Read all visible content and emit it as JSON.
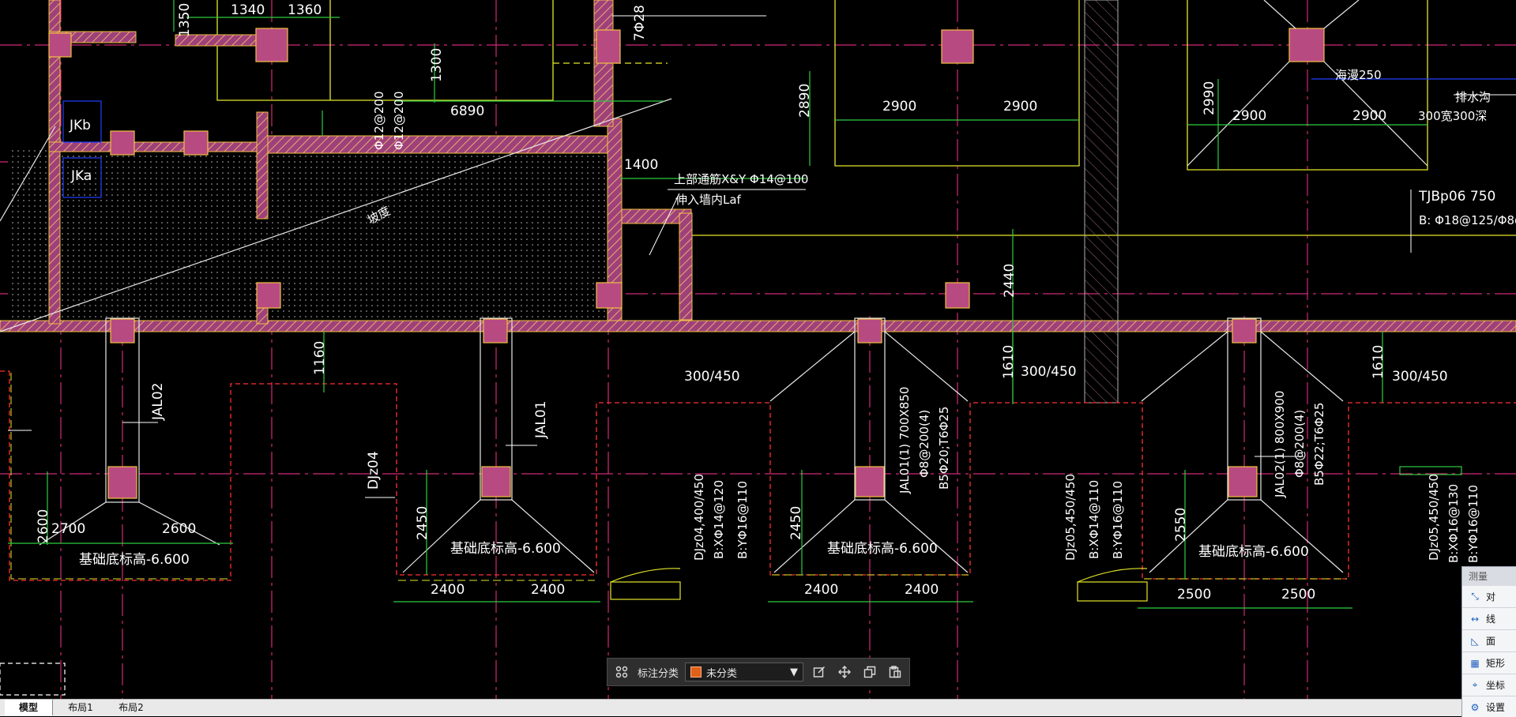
{
  "drawing": {
    "dims": {
      "d1350": "1350",
      "d1340": "1340",
      "d1360": "1360",
      "d1300": "1300",
      "d6890": "6890",
      "d1400": "1400",
      "d2890": "2890",
      "d2900a": "2900",
      "d2900b": "2900",
      "d2990": "2990",
      "d2900c": "2900",
      "d2900d": "2900",
      "d2440": "2440",
      "d1160": "1160",
      "d1610a": "1610",
      "d1610b": "1610",
      "d300_450a": "300/450",
      "d300_450b": "300/450",
      "d300_450c": "300/450",
      "d2700": "2700",
      "d2600a": "2600",
      "d2600b": "2600",
      "d2450a": "2450",
      "d2450b": "2450",
      "d2550": "2550",
      "d2400a": "2400",
      "d2400b": "2400",
      "d2400c": "2400",
      "d2400d": "2400",
      "d2500a": "2500",
      "d2500b": "2500"
    },
    "labels": {
      "jkb": "JKb",
      "jka": "JKa",
      "rebar_phi12": "Φ12@200",
      "rebar_phi12b": "Φ12@200",
      "top_rebar": "上部通筋X&Y Φ14@100",
      "extend": "伸入墙内Laf",
      "rebar7": "7Φ28",
      "haiyan": "海漫250",
      "drain": "排水沟",
      "drain_size": "300宽300深",
      "tjbp": "TJBp06 750",
      "tjbp_b": "B: Φ18@125/Φ8@",
      "jal02a": "JAL02",
      "jal01a": "JAL01",
      "djz04": "DJz04",
      "base_elev1": "基础底标高-6.600",
      "base_elev2": "基础底标高-6.600",
      "base_elev3": "基础底标高-6.600",
      "base_elev4": "基础底标高-6.600",
      "dj_1_a": "DJz04,400/450",
      "dj_1_b": "B:XΦ14@120",
      "dj_1_c": "B:YΦ16@110",
      "jal01_1": "JAL01(1) 700X850",
      "jal01_2": "Φ8@200(4)",
      "jal01_3": "B5Φ20;T6Φ25",
      "dj_2_a": "DJz05,450/450",
      "dj_2_b": "B:XΦ14@110",
      "dj_2_c": "B:YΦ16@110",
      "jal02_1": "JAL02(1) 800X900",
      "jal02_2": "Φ8@200(4)",
      "jal02_3": "B5Φ22;T6Φ25",
      "dj_3_a": "DJz05,450/450",
      "dj_3_b": "B:XΦ16@130",
      "dj_3_c": "B:YΦ16@110",
      "slope": "坡度"
    }
  },
  "toolbar": {
    "category_label": "标注分类",
    "category_value": "未分类",
    "category_color": "#e0601a",
    "icons": [
      "grid-icon",
      "edit-icon",
      "move-icon",
      "copy-icon",
      "paste-icon"
    ]
  },
  "tabs": [
    "模型",
    "布局1",
    "布局2"
  ],
  "measure_panel": {
    "title": "测量",
    "items": [
      "对",
      "线",
      "面",
      "矩形",
      "坐标",
      "设置"
    ]
  }
}
